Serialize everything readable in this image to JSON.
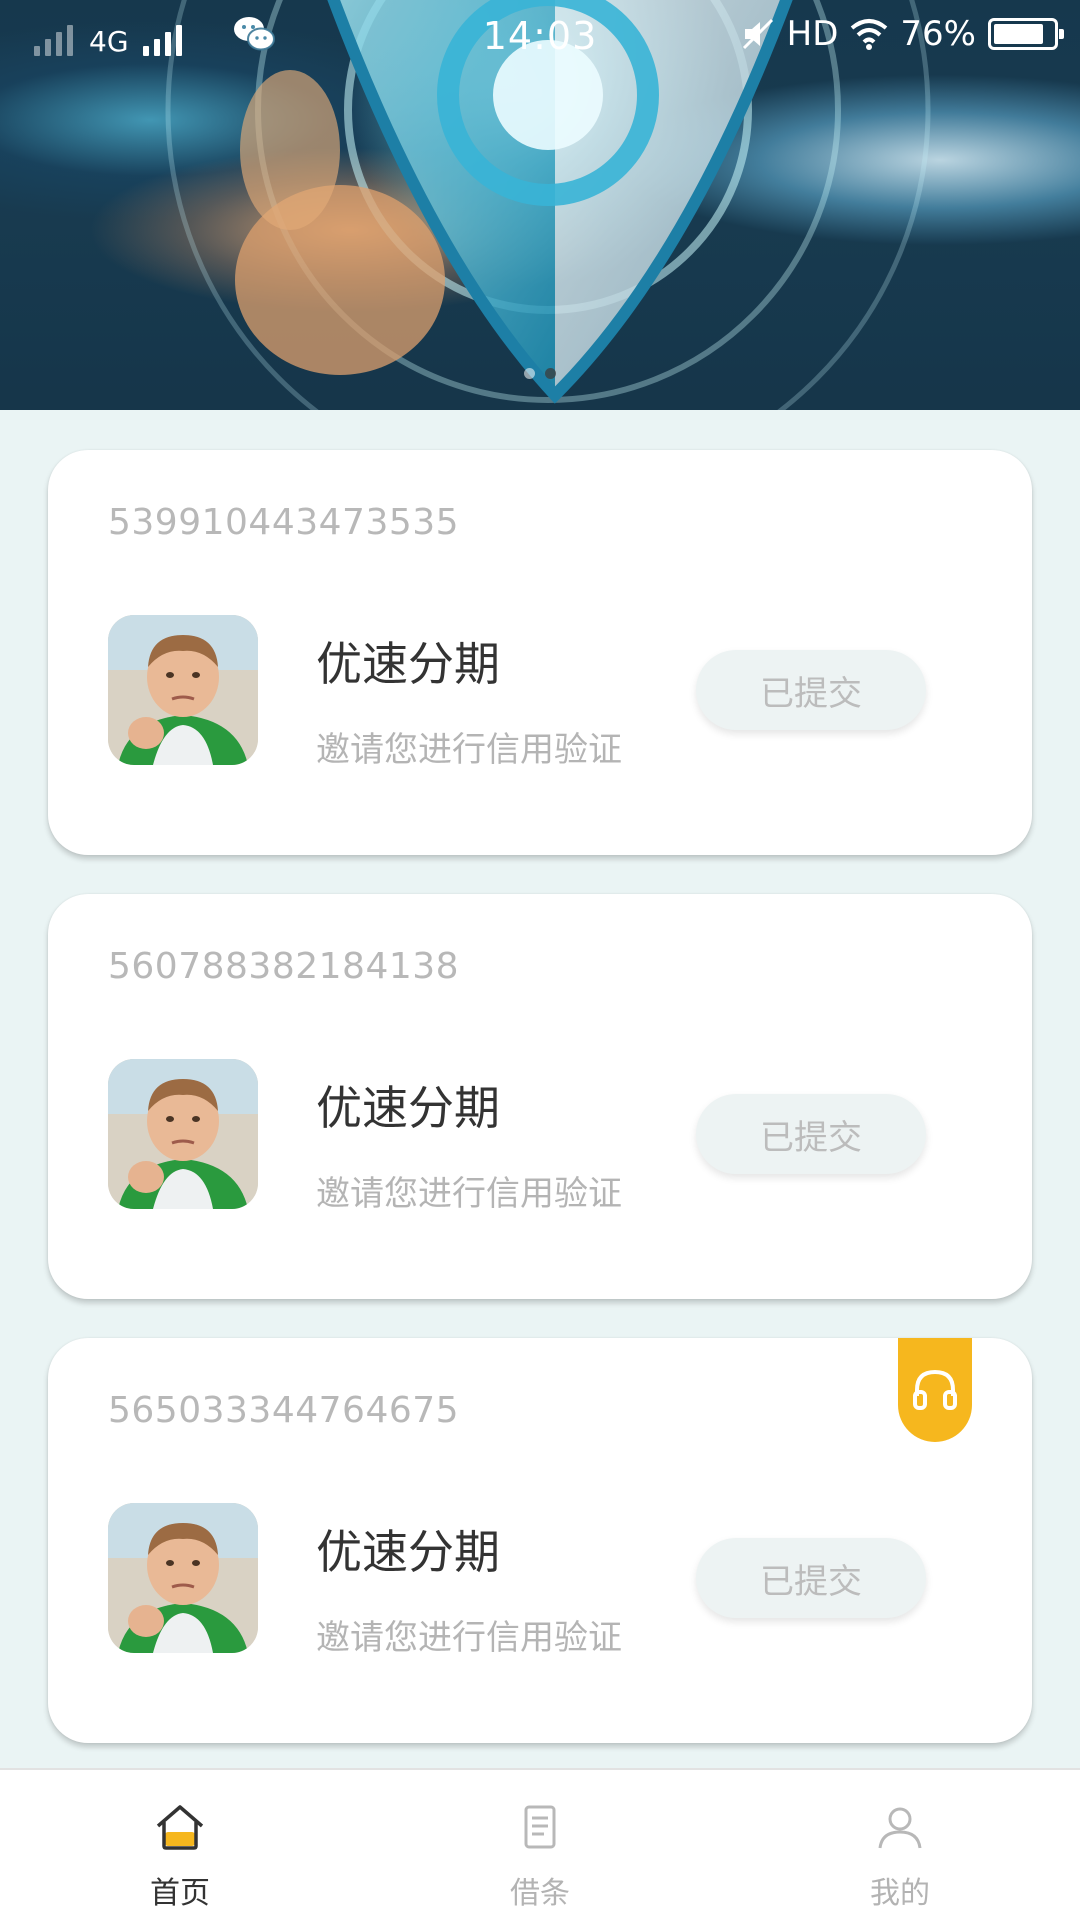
{
  "status_bar": {
    "network": "4G",
    "time": "14:03",
    "hd": "HD",
    "battery": "76%"
  },
  "banner": {
    "page_count": 2,
    "active_page": 2
  },
  "cards": [
    {
      "id": "539910443473535",
      "title": "优速分期",
      "subtitle": "邀请您进行信用验证",
      "button": "已提交"
    },
    {
      "id": "560788382184138",
      "title": "优速分期",
      "subtitle": "邀请您进行信用验证",
      "button": "已提交"
    },
    {
      "id": "565033344764675",
      "title": "优速分期",
      "subtitle": "邀请您进行信用验证",
      "button": "已提交"
    }
  ],
  "support": {
    "icon": "headset-icon",
    "color": "#f6b71e"
  },
  "bottom_nav": {
    "items": [
      {
        "label": "首页",
        "icon": "home-icon",
        "active": true
      },
      {
        "label": "借条",
        "icon": "document-icon",
        "active": false
      },
      {
        "label": "我的",
        "icon": "user-icon",
        "active": false
      }
    ]
  },
  "colors": {
    "accent": "#f6b71e",
    "background": "#eaf4f4",
    "card": "#ffffff",
    "muted_text": "#b4b4b4"
  }
}
